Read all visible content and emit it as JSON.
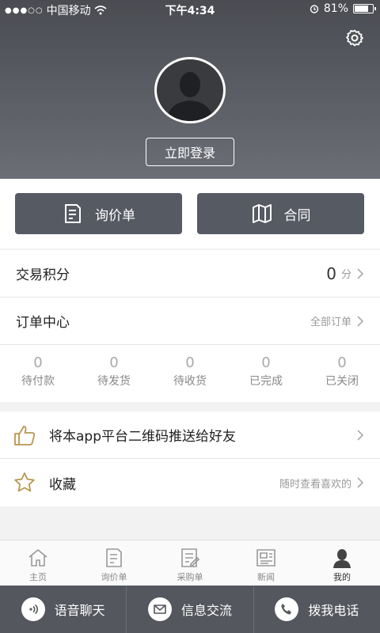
{
  "status_bar": {
    "carrier": "中国移动",
    "time": "下午4:34",
    "battery": "81%",
    "battery_level": 0.81
  },
  "profile": {
    "login_label": "立即登录"
  },
  "quick_actions": [
    {
      "label": "询价单",
      "icon": "inquiry-doc-icon"
    },
    {
      "label": "合同",
      "icon": "map-contract-icon"
    }
  ],
  "points": {
    "title": "交易积分",
    "value": "0",
    "unit": "分"
  },
  "orders": {
    "title": "订单中心",
    "all_label": "全部订单",
    "statuses": [
      {
        "count": "0",
        "label": "待付款"
      },
      {
        "count": "0",
        "label": "待发货"
      },
      {
        "count": "0",
        "label": "待收货"
      },
      {
        "count": "0",
        "label": "已完成"
      },
      {
        "count": "0",
        "label": "已关闭"
      }
    ]
  },
  "promo": {
    "share_label": "将本app平台二维码推送给好友",
    "favorites_label": "收藏",
    "favorites_hint": "随时查看喜欢的"
  },
  "tabs": [
    {
      "label": "主页",
      "icon": "home-icon"
    },
    {
      "label": "询价单",
      "icon": "inquiry-icon"
    },
    {
      "label": "采购单",
      "icon": "purchase-icon"
    },
    {
      "label": "新闻",
      "icon": "news-icon"
    },
    {
      "label": "我的",
      "icon": "profile-icon",
      "active": true
    }
  ],
  "contact_bar": [
    {
      "label": "语音聊天",
      "icon": "voice-icon"
    },
    {
      "label": "信息交流",
      "icon": "mail-icon"
    },
    {
      "label": "拨我电话",
      "icon": "phone-icon"
    }
  ],
  "colors": {
    "header": "#5e6068",
    "button": "#565a62",
    "accent_gold": "#b8964f",
    "contact_bar": "#55575e"
  }
}
